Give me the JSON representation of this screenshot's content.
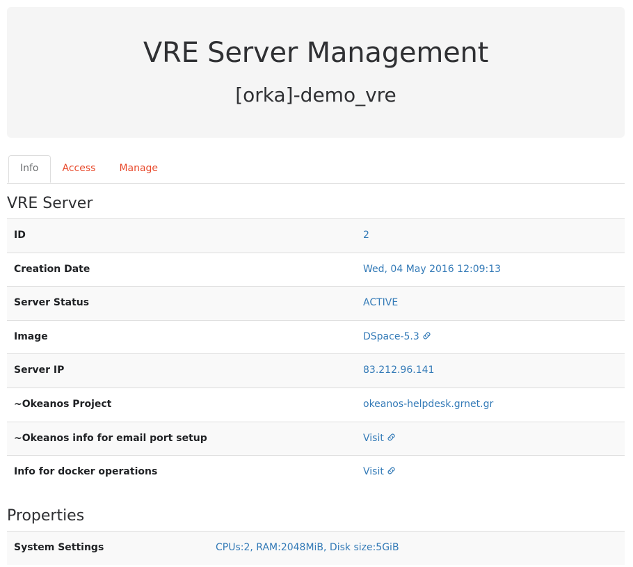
{
  "header": {
    "title": "VRE Server Management",
    "subtitle": "[orka]-demo_vre"
  },
  "tabs": [
    {
      "label": "Info",
      "active": true
    },
    {
      "label": "Access",
      "active": false
    },
    {
      "label": "Manage",
      "active": false
    }
  ],
  "sections": {
    "server": {
      "heading": "VRE Server",
      "rows": [
        {
          "label": "ID",
          "value": "2",
          "link": false,
          "icon": null
        },
        {
          "label": "Creation Date",
          "value": "Wed, 04 May 2016 12:09:13",
          "link": false,
          "icon": null
        },
        {
          "label": "Server Status",
          "value": "ACTIVE",
          "link": false,
          "icon": null
        },
        {
          "label": "Image",
          "value": "DSpace-5.3",
          "link": true,
          "icon": "chain-link-icon"
        },
        {
          "label": "Server IP",
          "value": "83.212.96.141",
          "link": false,
          "icon": null
        },
        {
          "label": "~Okeanos Project",
          "value": "okeanos-helpdesk.grnet.gr",
          "link": false,
          "icon": null
        },
        {
          "label": "~Okeanos info for email port setup",
          "value": "Visit",
          "link": true,
          "icon": "chain-link-icon"
        },
        {
          "label": "Info for docker operations",
          "value": "Visit",
          "link": true,
          "icon": "chain-link-icon"
        }
      ]
    },
    "properties": {
      "heading": "Properties",
      "rows": [
        {
          "label": "System Settings",
          "value": "CPUs:2, RAM:2048MiB, Disk size:5GiB",
          "link": false,
          "icon": null
        }
      ]
    }
  },
  "colors": {
    "link": "#337ab7",
    "tab_inactive": "#e8492b",
    "tab_active_text": "#6d6f71",
    "heading": "#2f3033",
    "card_bg": "#f5f5f5",
    "row_stripe": "#f9f9f9",
    "border": "#dddddd"
  }
}
